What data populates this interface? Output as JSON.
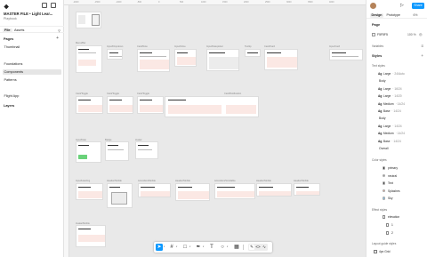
{
  "app": {
    "file_name": "MASTER FILE • Light Lear...",
    "file_sub": "Playbook"
  },
  "left_panel": {
    "tabs": [
      "File",
      "Assets"
    ],
    "pages_title": "Pages",
    "pages": [
      "Thumbnail"
    ],
    "sections": [
      "Foundations",
      "Components",
      "Patterns"
    ],
    "selected_section": "Components",
    "extras": [
      "Flight App",
      "Layers"
    ]
  },
  "canvas": {
    "ruler_ticks": [
      "-2000",
      "-1500",
      "-1000",
      "-500",
      "0",
      "500",
      "1000",
      "1500",
      "2000",
      "2500",
      "3000",
      "3500",
      "4000"
    ],
    "frame_labels": {
      "r1": [
        "Menu/Bar",
        "Input/Dropdown",
        "Card/Note",
        "Input/Inline",
        "Input/Datepicker",
        "Tooltip",
        "Card/Card",
        "Input/Card"
      ],
      "r2": [
        "Card/Toggle",
        "Card/Toggle",
        "Card/Toggle",
        "Card/Notification"
      ],
      "r3": [
        "Input/Date",
        "Badge",
        "Avatar"
      ],
      "r4": [
        "Input/Heading",
        "Header/Mobile",
        "Accordion/Mobile",
        "Header/Mobile",
        "Accordion/Scrollable",
        "Header/Mobile",
        "Header/Mobile"
      ],
      "r5": [
        "Avatar/Mobile"
      ]
    }
  },
  "toolbar": {
    "tools": [
      "move",
      "frame",
      "shape",
      "pen",
      "text",
      "comment",
      "actions"
    ],
    "modes": [
      "design",
      "dev",
      "draw"
    ]
  },
  "right_panel": {
    "tabs": [
      "Design",
      "Prototype"
    ],
    "zoom": "6%",
    "share_label": "Share",
    "page_title": "Page",
    "page_color": "F5F5F5",
    "page_opacity": "100",
    "page_opacity_unit": "%",
    "variables_label": "Variables",
    "styles_title": "Styles",
    "text_styles_label": "Text styles",
    "text_styles": [
      {
        "label": "Ag",
        "name": "Large",
        "spec": "24/Auto"
      },
      {
        "label": "",
        "name": "Body",
        "spec": ""
      },
      {
        "label": "Ag",
        "name": "Large",
        "spec": "16/24"
      },
      {
        "label": "Ag",
        "name": "Large",
        "spec": "14/20"
      },
      {
        "label": "Ag",
        "name": "Medium",
        "spec": "14/24"
      },
      {
        "label": "Ag",
        "name": "Base",
        "spec": "14/24"
      },
      {
        "label": "",
        "name": "Body",
        "spec": ""
      },
      {
        "label": "Ag",
        "name": "Large",
        "spec": "14/24"
      },
      {
        "label": "Ag",
        "name": "Medium",
        "spec": "14/24"
      },
      {
        "label": "Ag",
        "name": "Base",
        "spec": "14/24"
      },
      {
        "label": "",
        "name": "Overall",
        "spec": ""
      }
    ],
    "color_styles_label": "Color styles",
    "color_styles": [
      "primary",
      "neutral",
      "Text",
      "Splashes",
      "Sky"
    ],
    "effect_styles_label": "Effect styles",
    "effect_styles": [
      "elevation",
      "1",
      "2"
    ],
    "layout_styles_label": "Layout guide styles",
    "layout_styles": [
      "4px Grid"
    ]
  },
  "colors": {
    "accent": "#0d99ff",
    "selected_bg": "#e5e5e5",
    "canvas_bg": "#e9e9e9",
    "card_pink": "#fbe8e4",
    "badge_green": "#6ad27a"
  }
}
